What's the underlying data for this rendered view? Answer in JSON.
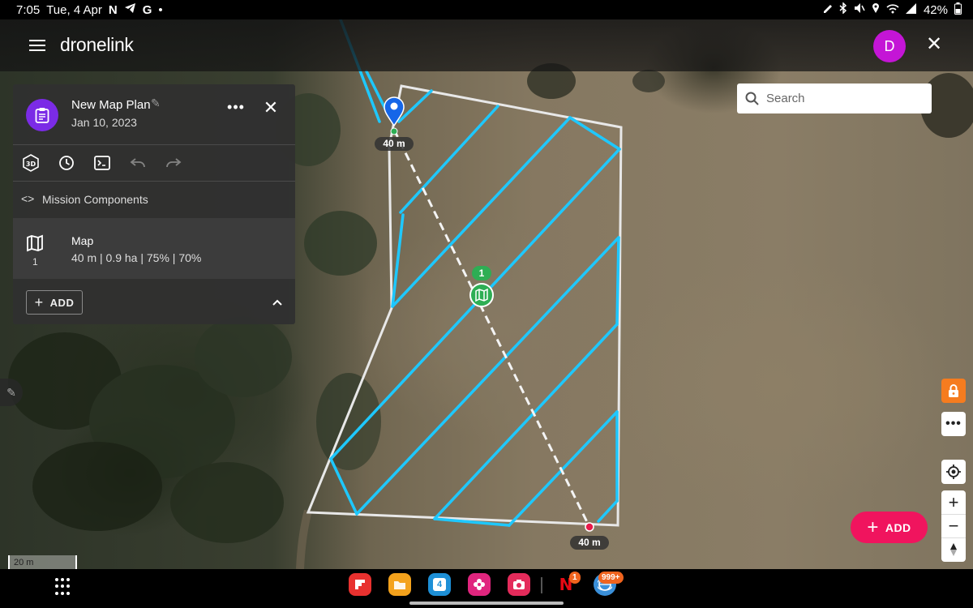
{
  "status_bar": {
    "time": "7:05",
    "date": "Tue, 4 Apr",
    "left_icons": [
      "netflix-notification-icon",
      "telegram-icon",
      "google-icon",
      "dot-icon"
    ],
    "right_icons": [
      "pen-icon",
      "bluetooth-icon",
      "mute-icon",
      "location-icon",
      "wifi-icon",
      "signal-icon",
      "battery-icon"
    ],
    "battery": "42%"
  },
  "app_bar": {
    "logo": "dronelink",
    "avatar_initial": "D",
    "avatar_color": "#c415d6"
  },
  "plan_panel": {
    "title": "New Map Plan",
    "date": "Jan 10, 2023",
    "more_label": "•••",
    "toolbar": [
      {
        "icon": "3d-view-icon",
        "enabled": true
      },
      {
        "icon": "history-icon",
        "enabled": true
      },
      {
        "icon": "terminal-icon",
        "enabled": true
      },
      {
        "icon": "undo-icon",
        "enabled": false
      },
      {
        "icon": "redo-icon",
        "enabled": false
      }
    ],
    "mission_components_code": "<>",
    "mission_components_label": "Mission Components",
    "component": {
      "index": "1",
      "name": "Map",
      "detail": "40 m | 0.9 ha | 75% | 70%"
    },
    "add_label": "ADD"
  },
  "search": {
    "placeholder": "Search"
  },
  "map": {
    "start_altitude_label": "40 m",
    "end_altitude_label": "40 m",
    "component_badge": "1",
    "scale_label": "20 m",
    "accent_color": "#1ec8ff",
    "boundary_color": "#e8e8e8"
  },
  "fab": {
    "label": "ADD",
    "color": "#f0145e"
  },
  "dock": {
    "apps": [
      "flipboard-icon",
      "files-icon",
      "calendar-icon",
      "blossom-icon",
      "camera-icon",
      "netflix-icon",
      "browser-icon"
    ],
    "calendar_day": "4",
    "netflix_letter": "N",
    "netflix_badge": "1",
    "browser_badge": "999+"
  }
}
